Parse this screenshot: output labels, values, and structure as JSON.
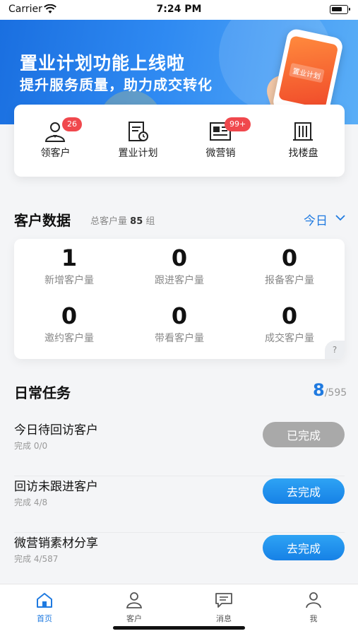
{
  "status_bar": {
    "carrier": "Carrier",
    "time": "7:24 PM"
  },
  "banner": {
    "title": "置业计划功能上线啦",
    "subtitle": "提升服务质量，助力成交转化",
    "phone_label": "置业计划"
  },
  "quick_actions": [
    {
      "label": "领客户",
      "icon": "user-claim-icon",
      "badge": "26"
    },
    {
      "label": "置业计划",
      "icon": "plan-document-icon",
      "badge": ""
    },
    {
      "label": "微营销",
      "icon": "newspaper-icon",
      "badge": "99+"
    },
    {
      "label": "找楼盘",
      "icon": "building-icon",
      "badge": ""
    }
  ],
  "customer_data": {
    "title": "客户数据",
    "total_label": "总客户量",
    "total_value": "85",
    "total_unit": "组",
    "period": "今日",
    "stats": [
      {
        "value": "1",
        "label": "新增客户量"
      },
      {
        "value": "0",
        "label": "跟进客户量"
      },
      {
        "value": "0",
        "label": "报备客户量"
      },
      {
        "value": "0",
        "label": "邀约客户量"
      },
      {
        "value": "0",
        "label": "带看客户量"
      },
      {
        "value": "0",
        "label": "成交客户量"
      }
    ],
    "help": "?"
  },
  "daily_tasks": {
    "title": "日常任务",
    "done": "8",
    "total": "/595",
    "items": [
      {
        "name": "今日待回访客户",
        "progress_label": "完成",
        "progress": "0/0",
        "button": "已完成",
        "state": "done"
      },
      {
        "name": "回访未跟进客户",
        "progress_label": "完成",
        "progress": "4/8",
        "button": "去完成",
        "state": "todo"
      },
      {
        "name": "微营销素材分享",
        "progress_label": "完成",
        "progress": "4/587",
        "button": "去完成",
        "state": "todo"
      }
    ]
  },
  "tab_bar": {
    "active": "首页",
    "accent": "#1f7ae0",
    "tabs": [
      {
        "label": "首页",
        "icon": "home-icon"
      },
      {
        "label": "客户",
        "icon": "customer-icon"
      },
      {
        "label": "消息",
        "icon": "message-icon"
      },
      {
        "label": "我",
        "icon": "profile-icon"
      }
    ]
  }
}
